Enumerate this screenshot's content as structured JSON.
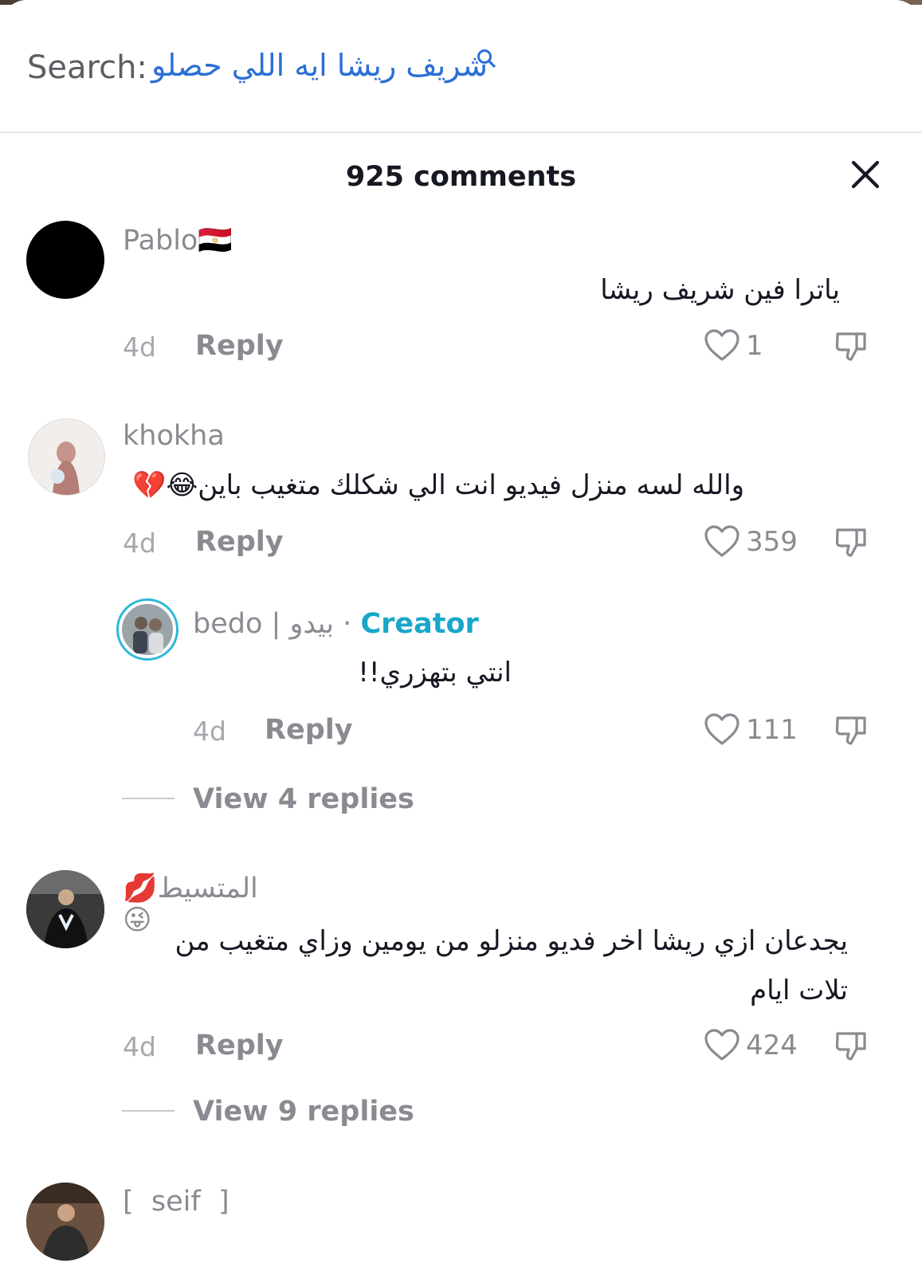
{
  "search": {
    "label": "Search:",
    "query": "شريف ريشا ايه اللي حصلو"
  },
  "header": {
    "count_label": "925 comments"
  },
  "comments": [
    {
      "user": "Pablo🇪🇬",
      "text": "ياترا فين شريف ريشا",
      "time": "4d",
      "reply": "Reply",
      "likes": "1"
    },
    {
      "user": "khokha",
      "text": "والله لسه منزل فيديو انت الي شكلك متغيب باين😂💔",
      "time": "4d",
      "reply": "Reply",
      "likes": "359",
      "reply_item": {
        "user": "bedo | بيدو",
        "separator": "·",
        "badge": "Creator",
        "text": "انتي بتهزري!!",
        "time": "4d",
        "reply": "Reply",
        "likes": "111"
      },
      "view_replies": "View 4 replies"
    },
    {
      "user": "المتسيط💋😜",
      "text": "يجدعان ازي ريشا اخر فديو منزلو من يومين وزاي متغيب من تلات ايام",
      "time": "4d",
      "reply": "Reply",
      "likes": "424",
      "view_replies": "View 9 replies"
    },
    {
      "user": "[  seif  ]"
    }
  ],
  "icons": {
    "search": "search-icon",
    "close": "close-icon",
    "heart": "heart-icon",
    "dislike": "dislike-icon"
  },
  "colors": {
    "creator_badge": "#18a7c9",
    "search_query": "#2b6fd6"
  }
}
